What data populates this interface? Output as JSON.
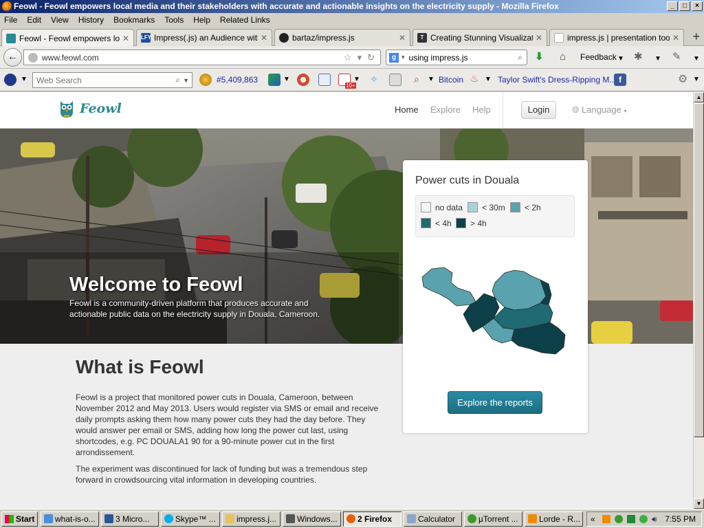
{
  "window": {
    "title": "Feowl - Feowl empowers local media and their stakeholders with accurate and actionable insights on the electricity supply - Mozilla Firefox",
    "buttons": [
      "_",
      "□",
      "×"
    ]
  },
  "menubar": [
    "File",
    "Edit",
    "View",
    "History",
    "Bookmarks",
    "Tools",
    "Help",
    "Related Links"
  ],
  "tabs": [
    {
      "label": "Feowl - Feowl empowers local ...",
      "icon": "feowl-favicon",
      "active": true
    },
    {
      "label": "Impress(.js) an Audience with ...",
      "icon": "lfy-favicon",
      "active": false
    },
    {
      "label": "bartaz/impress.js",
      "icon": "github-favicon",
      "active": false
    },
    {
      "label": "Creating Stunning Visualization...",
      "icon": "t-favicon",
      "active": false
    },
    {
      "label": "impress.js | presentation tool ...",
      "icon": "blank-favicon",
      "active": false
    }
  ],
  "navbar": {
    "url": "www.feowl.com",
    "search_engine_icon": "g",
    "search_value": "using impress.js",
    "feedback": "Feedback"
  },
  "toolbar2": {
    "web_search_placeholder": "Web Search",
    "counter": "#5,409,863",
    "bitcoin": "Bitcoin",
    "news_link": "Taylor Swift's Dress-Ripping M...",
    "gmail_badge": "10+"
  },
  "site": {
    "logo_text": "Feowl",
    "nav": {
      "home": "Home",
      "explore": "Explore",
      "help": "Help"
    },
    "login": "Login",
    "language": "Language",
    "hero": {
      "title": "Welcome to Feowl",
      "subtitle": "Feowl is a community-driven platform that produces accurate and actionable public data on the electricity supply in Douala, Cameroon."
    },
    "what": {
      "title": "What is Feowl",
      "p1": "Feowl is a project that monitored power cuts in Douala, Cameroon, between November 2012 and May 2013. Users would register via SMS or email and receive daily prompts asking them how many power cuts they had the day before. They would answer per email or SMS, adding how long the power cut last, using shortcodes, e.g. PC DOUALA1 90 for a 90-minute power cut in the first arrondissement.",
      "p2": "The experiment was discontinued for lack of funding but was a tremendous step forward in crowdsourcing vital information in developing countries."
    },
    "card": {
      "title": "Power cuts in Douala",
      "legend": [
        {
          "label": "no data",
          "color": "#f4f4f4"
        },
        {
          "label": "< 30m",
          "color": "#a7d2d6"
        },
        {
          "label": "< 2h",
          "color": "#5aa2ad"
        },
        {
          "label": "< 4h",
          "color": "#1f6a73"
        },
        {
          "label": "> 4h",
          "color": "#0d4048"
        }
      ],
      "button": "Explore the reports"
    }
  },
  "taskbar": {
    "start": "Start",
    "tasks": [
      "what-is-o...",
      "3 Micro...",
      "Skype™ ...",
      "impress.j...",
      "Windows...",
      "2 Firefox",
      "Calculator",
      "µTorrent ...",
      "Lorde - R..."
    ],
    "tray_chevron": "«",
    "clock": "7:55 PM"
  }
}
